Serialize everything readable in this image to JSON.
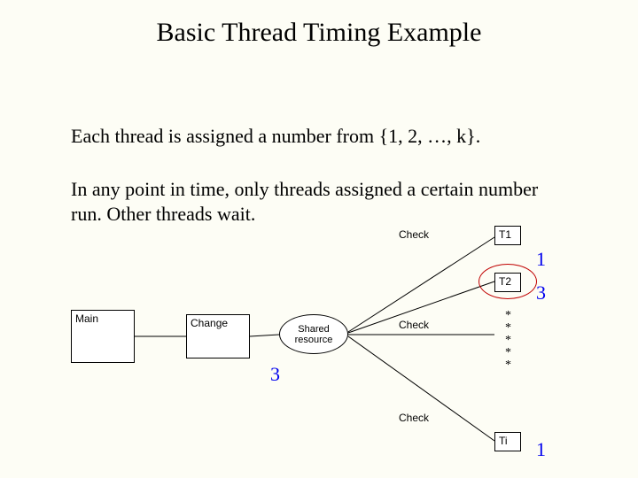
{
  "title": "Basic Thread Timing Example",
  "paragraphs": [
    "Each thread is assigned a number from {1, 2, …, k}.",
    "In any point in time, only threads assigned a certain number run. Other threads wait."
  ],
  "boxes": {
    "main": "Main",
    "change": "Change",
    "shared": "Shared resource",
    "t1": "T1",
    "t2": "T2",
    "ti": "Ti"
  },
  "edge_label": "Check",
  "numbers": {
    "t1": "1",
    "t2": "3",
    "shared": "3",
    "ti": "1"
  }
}
